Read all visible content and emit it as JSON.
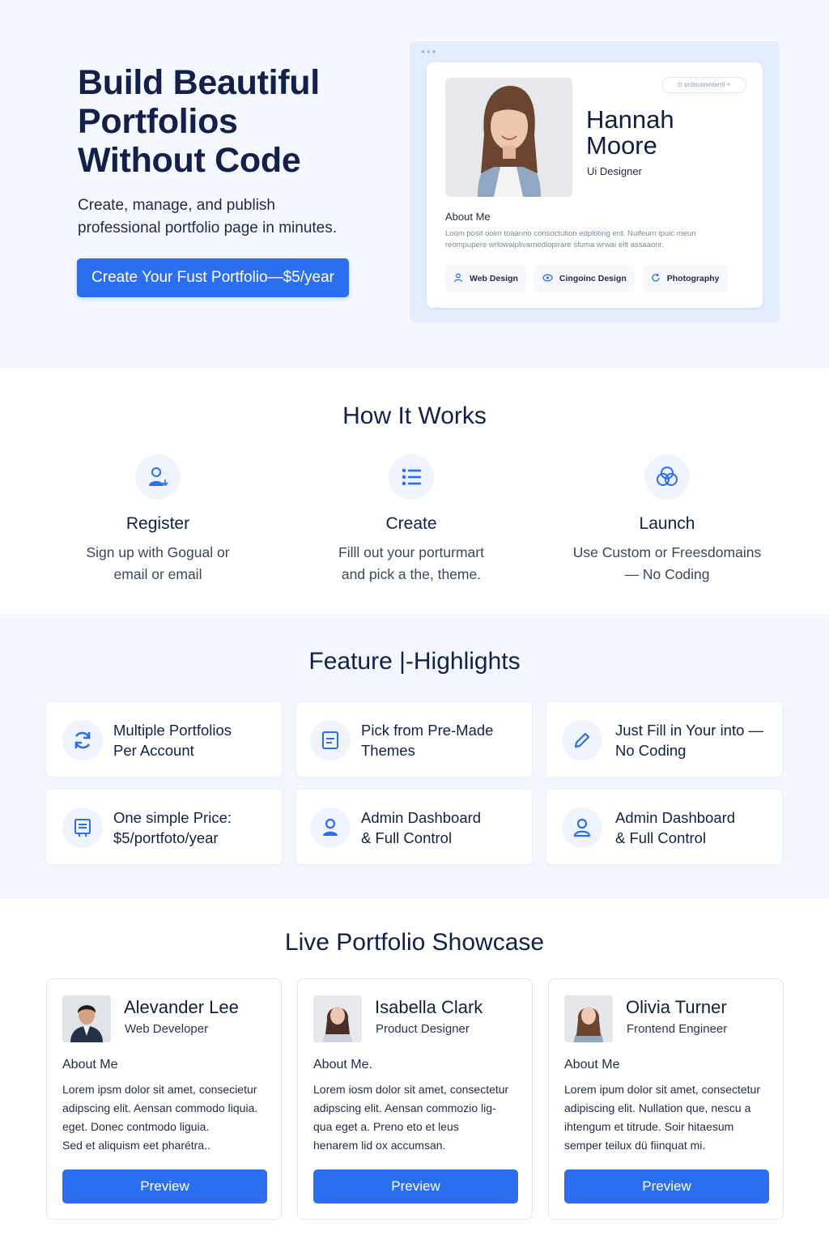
{
  "hero": {
    "title_lines": [
      "Build Beautiful",
      "Portfolios",
      "Without Code"
    ],
    "subtitle_lines": [
      "Create, manage, and publish",
      "professional portfolio page in minutes."
    ],
    "cta_label": "Create Your Fust Portfolio—$5/year",
    "mock": {
      "pill": "⊙ prdeuwsnternl ×",
      "name_lines": [
        "Hannah",
        "Moore"
      ],
      "role": "Ui Designer",
      "about_heading": "About Me",
      "about_lines": [
        "Loom posit ooim toaanno consoctution edploting ent. Nuifeurn ipuic meun",
        "reompupere wrlowalplivarnedlopirare sfuma wrwai ellt assaaonr."
      ],
      "tags": [
        {
          "icon": "person-icon",
          "label": "Web Design"
        },
        {
          "icon": "eye-icon",
          "label": "Cingoinc Design"
        },
        {
          "icon": "refresh-icon",
          "label": "Photography"
        }
      ]
    }
  },
  "how": {
    "title": "How It Works",
    "steps": [
      {
        "title": "Register",
        "desc_lines": [
          "Sign up with Gogual or",
          "email or email"
        ]
      },
      {
        "title": "Create",
        "desc_lines": [
          "Filll out your porturmart",
          "and pick a the, theme."
        ]
      },
      {
        "title": "Launch",
        "desc_lines": [
          "Use Custom or Freesdomains",
          "— No Coding"
        ]
      }
    ]
  },
  "features": {
    "title": "Feature |-Highlights",
    "items": [
      {
        "icon": "sync-icon",
        "lines": [
          "Multiple Portfolios",
          "Per Account"
        ]
      },
      {
        "icon": "document-icon",
        "lines": [
          "Pick from Pre-Made",
          "Themes"
        ]
      },
      {
        "icon": "pencil-icon",
        "lines": [
          "Just Fill in Your into —",
          "No Coding"
        ]
      },
      {
        "icon": "invoice-icon",
        "lines": [
          "One simple Price:",
          "$5/portfoto/year"
        ]
      },
      {
        "icon": "user-icon",
        "lines": [
          "Admin Dashboard",
          "& Full Control"
        ]
      },
      {
        "icon": "user-outline-icon",
        "lines": [
          "Admin Dashboard",
          "& Full Control"
        ]
      }
    ]
  },
  "showcase": {
    "title": "Live Portfolio Showcase",
    "cards": [
      {
        "name": "Alevander Lee",
        "role": "Web Developer",
        "about": "About Me",
        "lines": [
          "Lorem ipsm dolor sit amet, consecietur",
          "adipscing elit. Aensan commodo liquia.",
          "eget. Donec contmodo liguia.",
          "Sed et aliquism eet pharétra.."
        ],
        "button": "Preview"
      },
      {
        "name": "Isabella Clark",
        "role": "Product Designer",
        "about": "About Me.",
        "lines": [
          "Lorem iosm dolor sit amet, consectetur",
          "adipscing elit. Aensan commozio lig-",
          "qua eget a. Preno eto et leus",
          "henarem lid ox accumsan."
        ],
        "button": "Preview"
      },
      {
        "name": "Olivia Turner",
        "role": "Frontend Engineer",
        "about": "About Me",
        "lines": [
          "Lorem ipum dolor sit amet, consectetur",
          "adipiscing elit. Nullation que, nescu a",
          "ihtengum et titrude. Soir hitaesum",
          "semper teilux dü fiinquat mi."
        ],
        "button": "Preview"
      }
    ]
  },
  "colors": {
    "accent": "#2b6ff0",
    "heading": "#12204a",
    "hero_bg": "#f4f8fe",
    "feature_bg": "#f3f7fd"
  }
}
